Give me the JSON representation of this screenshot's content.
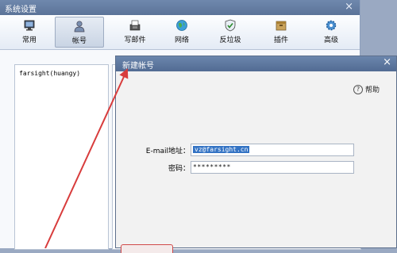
{
  "main_window": {
    "title": "系统设置",
    "close_label": "×",
    "toolbar": [
      {
        "label": "常用",
        "icon": "monitor-icon"
      },
      {
        "label": "帐号",
        "icon": "user-icon"
      },
      {
        "label": "写邮件",
        "icon": "compose-icon"
      },
      {
        "label": "网络",
        "icon": "globe-icon"
      },
      {
        "label": "反垃圾",
        "icon": "shield-icon"
      },
      {
        "label": "插件",
        "icon": "plugin-icon"
      },
      {
        "label": "高级",
        "icon": "gear-icon"
      }
    ],
    "active_tab": "帐号",
    "account_list": [
      "farsight(huangy)"
    ]
  },
  "dialog": {
    "title": "新建帐号",
    "close_label": "×",
    "help_label": "帮助",
    "help_icon_glyph": "?",
    "email_label": "E-mail地址：",
    "email_value": "vz@farsight.cn",
    "password_label": "密码：",
    "password_value": "*********"
  },
  "colors": {
    "titlebar": "#5b7398",
    "selection": "#3373c4",
    "arrow": "#d83c3c"
  }
}
